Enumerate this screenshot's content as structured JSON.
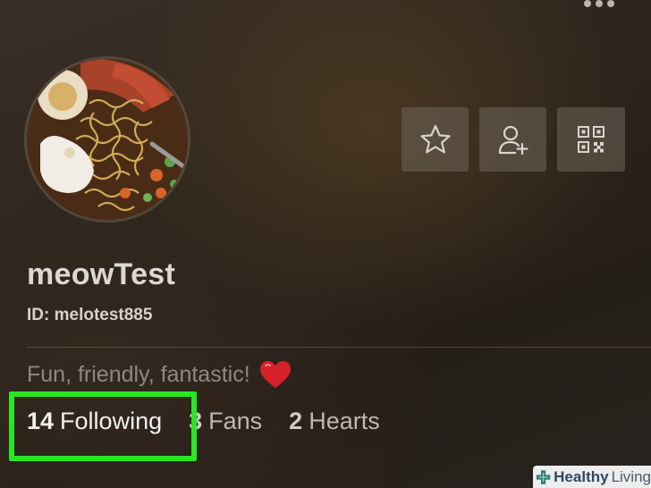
{
  "header": {
    "more_icon": "more-dots-icon"
  },
  "profile": {
    "avatar_alt": "noodle-bowl-photo",
    "username": "meowTest",
    "user_id": "ID: melotest885",
    "bio_text": "Fun, friendly, fantastic!",
    "bio_emoji": "heart-emoji"
  },
  "actions": {
    "favorite_icon": "star-icon",
    "add_friend_icon": "add-user-icon",
    "qr_icon": "qr-code-icon"
  },
  "stats": {
    "following_count": "14",
    "following_label": "Following",
    "fans_count": "3",
    "fans_label": "Fans",
    "hearts_count": "2",
    "hearts_label": "Hearts"
  },
  "highlight": {
    "target": "following",
    "color": "#29e623"
  },
  "watermark": {
    "healthy": "Healthy",
    "living": "Living"
  },
  "colors": {
    "accent_highlight": "#29e623",
    "heart": "#d8202a"
  }
}
